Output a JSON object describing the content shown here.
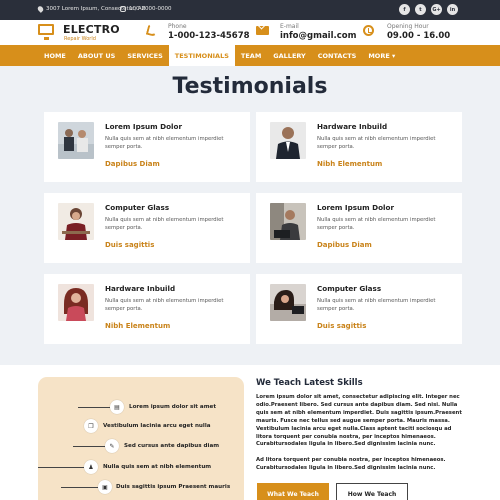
{
  "topbar": {
    "address": "3007 Lorem Ipsum, Consectetur, AB",
    "phone": "100-2000-0000",
    "socials": [
      "f",
      "t",
      "G+",
      "in"
    ]
  },
  "header": {
    "brand": "ELECTRO",
    "brand_sub": "Repair World",
    "phone_label": "Phone",
    "phone_value": "1-000-123-45678",
    "email_label": "E-mail",
    "email_value": "info@gmail.com",
    "hours_label": "Opening Hour",
    "hours_value": "09.00 - 16.00"
  },
  "nav": {
    "items": [
      "HOME",
      "ABOUT US",
      "SERVICES",
      "TESTIMONIALS",
      "TEAM",
      "GALLERY",
      "CONTACTS",
      "MORE ▾"
    ],
    "active_index": 3
  },
  "page": {
    "title": "Testimonials"
  },
  "testimonials": [
    {
      "name": "Lorem Ipsum Dolor",
      "text": "Nulla quis sem at nibh elementum imperdiet semper porta.",
      "author": "Dapibus Diam"
    },
    {
      "name": "Hardware Inbuild",
      "text": "Nulla quis sem at nibh elementum imperdiet semper porta.",
      "author": "Nibh Elementum"
    },
    {
      "name": "Computer Glass",
      "text": "Nulla quis sem at nibh elementum imperdiet semper porta.",
      "author": "Duis sagittis"
    },
    {
      "name": "Lorem Ipsum Dolor",
      "text": "Nulla quis sem at nibh elementum imperdiet semper porta.",
      "author": "Dapibus Diam"
    },
    {
      "name": "Hardware Inbuild",
      "text": "Nulla quis sem at nibh elementum imperdiet semper porta.",
      "author": "Nibh Elementum"
    },
    {
      "name": "Computer Glass",
      "text": "Nulla quis sem at nibh elementum imperdiet semper porta.",
      "author": "Duis sagittis"
    }
  ],
  "panel": {
    "items": [
      {
        "text": "Lorem ipsum dolor sit amet",
        "icon": "document-icon"
      },
      {
        "text": "Vestibulum lacinia arcu eget nulla",
        "icon": "copy-icon"
      },
      {
        "text": "Sed cursus ante dapibus diam",
        "icon": "pencil-icon"
      },
      {
        "text": "Nulla quis sem at nibh elementum",
        "icon": "people-icon"
      },
      {
        "text": "Duis sagittis ipsum Praesent mauris",
        "icon": "bag-icon"
      }
    ]
  },
  "teach": {
    "title": "We Teach Latest Skills",
    "paragraph1": "Lorem ipsum dolor sit amet, consectetur adipiscing elit. Integer nec odio.Praesent libero. Sed cursus ante dapibus diam. Sed nisi. Nulla quis sem at nibh elementum imperdiet. Duis sagittis ipsum.Praesent mauris. Fusce nec tellus sed augue semper porta. Mauris massa. Vestibulum lacinia arcu eget nulla.Class aptent taciti sociosqu ad litora torquent per conubia nostra, per inceptos himenaeos. Curabitursodales ligula in libero.Sed dignissim lacinia nunc.",
    "paragraph2": "Ad litora torquent per conubia nostra, per inceptos himenaeos. Curabitursodales ligula in libero.Sed dignissim lacinia nunc.",
    "primary_button": "What We Teach",
    "secondary_button": "How We Teach"
  },
  "colors": {
    "accent": "#d78f1b",
    "topbar": "#2a2f3a",
    "panel": "#f6e3c7"
  }
}
